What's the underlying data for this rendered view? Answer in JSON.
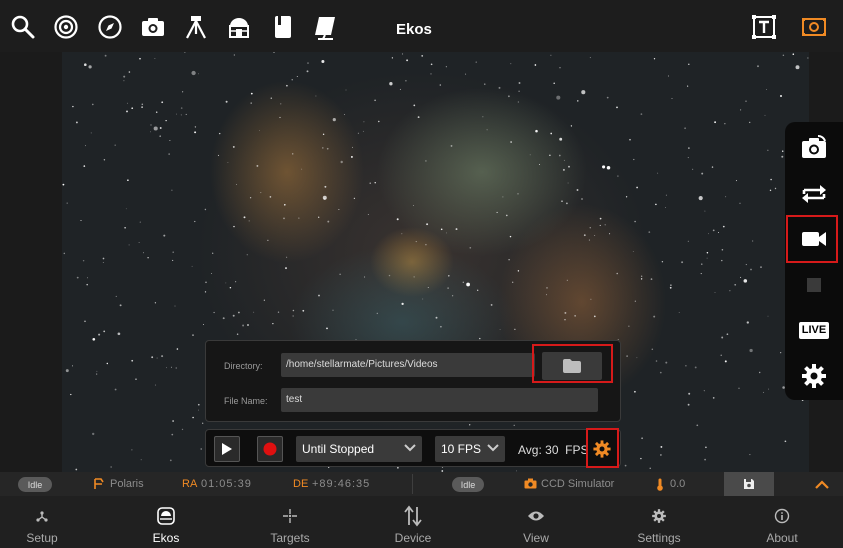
{
  "app": {
    "title": "Ekos"
  },
  "colors": {
    "accent": "#f08a24",
    "highlight": "#d61a1a",
    "record": "#e01010"
  },
  "top_toolbar": {
    "icons": [
      "search-icon",
      "target-icon",
      "compass-icon",
      "camera-icon",
      "tripod-icon",
      "observatory-icon",
      "notebook-icon",
      "flat-panel-icon",
      "text-frame-icon",
      "image-frame-icon"
    ]
  },
  "right_toolbar": {
    "icons": [
      "camera-rotate-icon",
      "loop-icon",
      "video-camera-icon",
      "stop-icon",
      "live-icon",
      "gear-icon"
    ],
    "live_label": "LIVE"
  },
  "record_panel": {
    "directory_label": "Directory:",
    "directory_value": "/home/stellarmate/Pictures/Videos",
    "filename_label": "File Name:",
    "filename_value": "test",
    "duration_option": "Until Stopped",
    "fps_option": "10 FPS",
    "avg_label": "Avg:",
    "avg_value": "30",
    "fps_unit": "FPS"
  },
  "status_bar": {
    "mount_state": "Idle",
    "mount_name": "Polaris",
    "ra_label": "RA",
    "ra_value": "01:05:39",
    "de_label": "DE",
    "de_value": "+89:46:35",
    "camera_state": "Idle",
    "camera_name": "CCD Simulator",
    "temperature": "0.0"
  },
  "bottom_nav": {
    "items": [
      {
        "label": "Setup",
        "icon": "setup-icon"
      },
      {
        "label": "Ekos",
        "icon": "ekos-icon"
      },
      {
        "label": "Targets",
        "icon": "targets-icon"
      },
      {
        "label": "Device",
        "icon": "device-icon"
      },
      {
        "label": "View",
        "icon": "eye-icon"
      },
      {
        "label": "Settings",
        "icon": "gear-icon"
      },
      {
        "label": "About",
        "icon": "info-icon"
      }
    ],
    "active": "Ekos"
  }
}
